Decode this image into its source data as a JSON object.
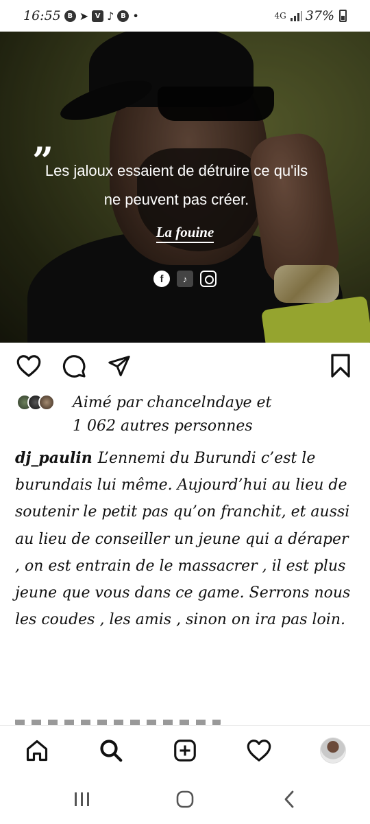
{
  "status_bar": {
    "time": "16:55",
    "left_icons": [
      "b-icon",
      "telegram-icon",
      "v-icon",
      "tiktok-icon",
      "b-circle-icon",
      "dot"
    ],
    "network_label": "4G",
    "battery": "37%"
  },
  "post": {
    "image": {
      "quote_mark": "„",
      "quote_line_1": "Les jaloux essaient de détruire ce qu'ils",
      "quote_line_2": "ne peuvent pas créer.",
      "author": "La fouine",
      "social_icons": [
        "facebook-icon",
        "tiktok-icon",
        "instagram-icon"
      ]
    },
    "likes": {
      "line1": "Aimé par chancelndaye et",
      "line2": "1 062 autres personnes"
    },
    "caption": {
      "username": "dj_paulin",
      "text": "L’ennemi du Burundi c’est le burundais lui même. Aujourd’hui au lieu de soutenir le petit pas qu’on franchit, et aussi au lieu de conseiller un jeune qui a déraper , on est entrain de le massacrer , il est plus jeune que vous dans ce game. Serrons nous les coudes , les amis , sinon on ira pas loin."
    }
  },
  "colors": {
    "background": "#ffffff",
    "text": "#111111",
    "image_tint": "#4f5528",
    "sleeve_accent": "#cfe342"
  }
}
